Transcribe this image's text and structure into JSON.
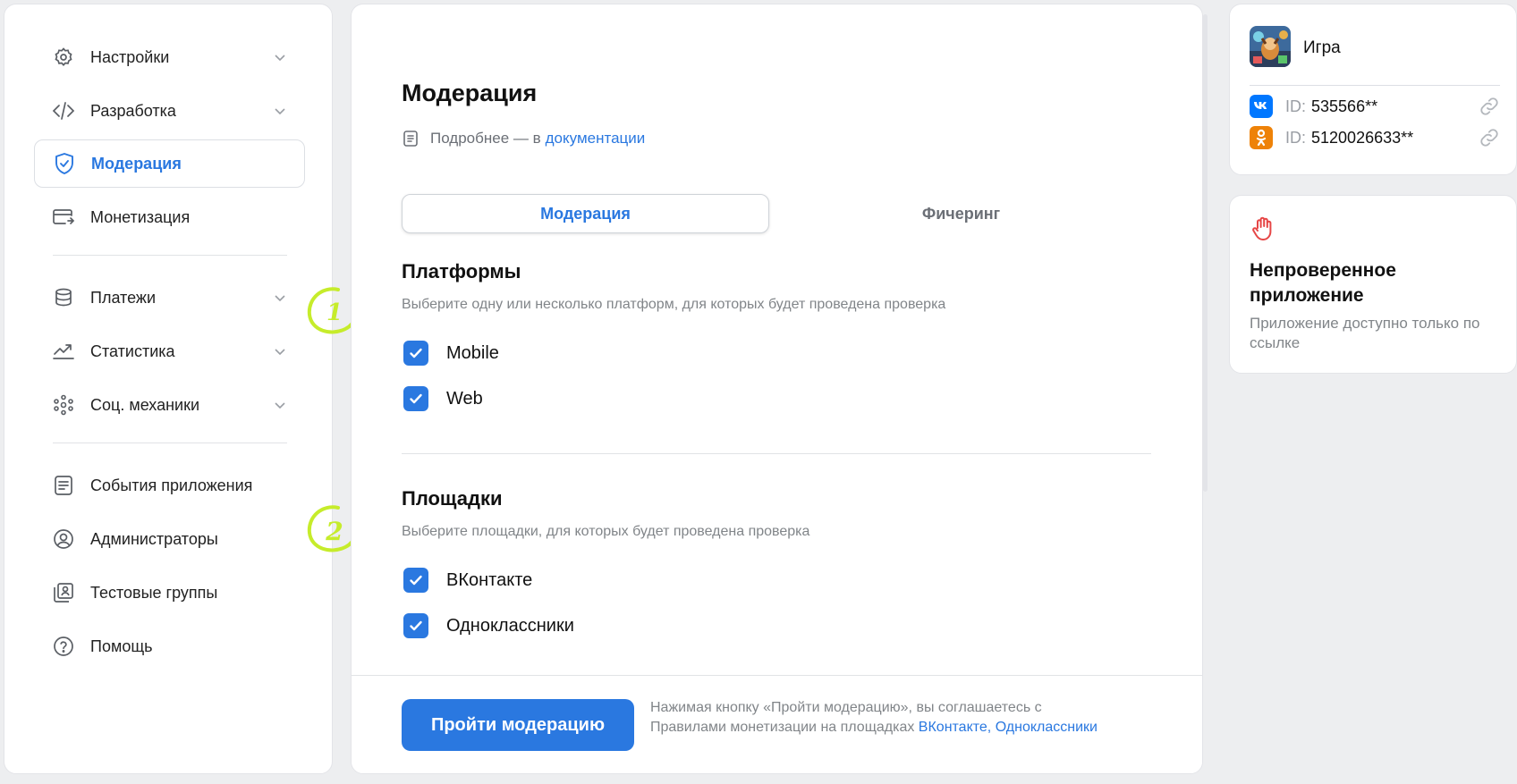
{
  "sidebar": {
    "items": [
      {
        "label": "Настройки",
        "icon": "gear-icon"
      },
      {
        "label": "Разработка",
        "icon": "code-icon"
      },
      {
        "label": "Модерация",
        "icon": "shield-icon"
      },
      {
        "label": "Монетизация",
        "icon": "card-icon"
      },
      {
        "label": "Платежи",
        "icon": "coins-icon"
      },
      {
        "label": "Статистика",
        "icon": "chart-icon"
      },
      {
        "label": "Соц. механики",
        "icon": "social-icon"
      },
      {
        "label": "События приложения",
        "icon": "events-icon"
      },
      {
        "label": "Администраторы",
        "icon": "user-circle-icon"
      },
      {
        "label": "Тестовые группы",
        "icon": "test-groups-icon"
      },
      {
        "label": "Помощь",
        "icon": "help-icon"
      }
    ]
  },
  "main": {
    "title": "Модерация",
    "doc_prefix": "Подробнее — в",
    "doc_link": "документации",
    "tabs": [
      "Модерация",
      "Фичеринг"
    ],
    "platforms": {
      "title": "Платформы",
      "description": "Выберите одну или несколько платформ, для которых будет проведена проверка",
      "options": [
        {
          "label": "Mobile",
          "checked": true
        },
        {
          "label": "Web",
          "checked": true
        }
      ]
    },
    "venues": {
      "title": "Площадки",
      "description": "Выберите площадки, для которых будет проведена проверка",
      "options": [
        {
          "label": "ВКонтакте",
          "checked": true
        },
        {
          "label": "Одноклассники",
          "checked": true
        }
      ]
    },
    "footer": {
      "button": "Пройти модерацию",
      "note_text": "Нажимая кнопку «Пройти модерацию», вы соглашаетесь с Правилами монетизации на площадках",
      "note_link1": "ВКонтакте",
      "note_comma": ",",
      "note_link2": "Одноклассники"
    }
  },
  "app_card": {
    "name": "Игра",
    "ids": [
      {
        "platform": "vk-logo-icon",
        "label": "ID:",
        "value": "535566**",
        "color": "#0077ff"
      },
      {
        "platform": "ok-logo-icon",
        "label": "ID:",
        "value": "5120026633**",
        "color": "#ee8208"
      }
    ]
  },
  "status_card": {
    "title": "Непроверенное приложение",
    "description": "Приложение доступно только по ссылке",
    "icon": "hand-stop-icon",
    "icon_color": "#e64646"
  },
  "annotations": [
    "1",
    "2"
  ],
  "colors": {
    "accent": "#2a78e0",
    "annotation": "#c6ec2b"
  }
}
